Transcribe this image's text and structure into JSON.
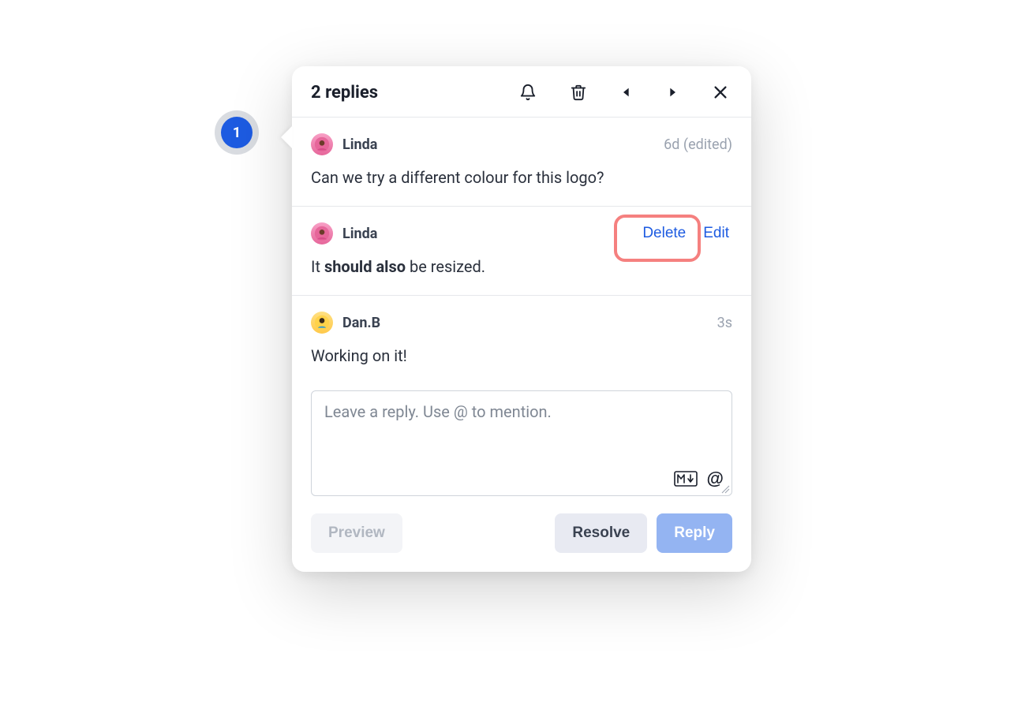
{
  "annotation": {
    "number": "1"
  },
  "header": {
    "title": "2 replies"
  },
  "comments": [
    {
      "author": "Linda",
      "avatar_style": "pink",
      "meta": "6d (edited)",
      "body_prefix": "Can we try a different colour for this logo?",
      "body_bold": "",
      "body_suffix": ""
    },
    {
      "author": "Linda",
      "avatar_style": "pink",
      "actions": {
        "delete": "Delete",
        "edit": "Edit"
      },
      "body_prefix": "It ",
      "body_bold": "should also",
      "body_suffix": " be resized."
    },
    {
      "author": "Dan.B",
      "avatar_style": "yellow",
      "meta": "3s",
      "body_prefix": "Working on it!",
      "body_bold": "",
      "body_suffix": ""
    }
  ],
  "reply": {
    "placeholder": "Leave a reply. Use @ to mention."
  },
  "buttons": {
    "preview": "Preview",
    "resolve": "Resolve",
    "reply": "Reply"
  }
}
